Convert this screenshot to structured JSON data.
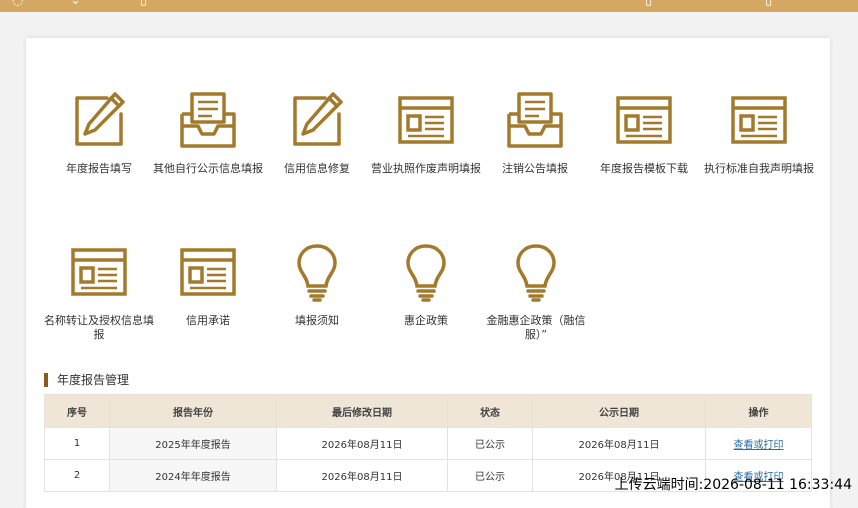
{
  "topbar": {
    "bg": "#d4a862"
  },
  "tiles_row1": [
    {
      "label": "年度报告填写",
      "icon": "pencil-edit-icon"
    },
    {
      "label": "其他自行公示信息填报",
      "icon": "inbox-tray-icon"
    },
    {
      "label": "信用信息修复",
      "icon": "pencil-edit-icon"
    },
    {
      "label": "营业执照作废声明填报",
      "icon": "document-window-icon"
    },
    {
      "label": "注销公告填报",
      "icon": "inbox-tray-icon"
    },
    {
      "label": "年度报告模板下载",
      "icon": "document-window-icon"
    },
    {
      "label": "执行标准自我声明填报",
      "icon": "document-window-icon"
    }
  ],
  "tiles_row2": [
    {
      "label": "名称转让及授权信息填报",
      "icon": "document-window-icon"
    },
    {
      "label": "信用承诺",
      "icon": "document-window-icon"
    },
    {
      "label": "填报须知",
      "icon": "lightbulb-icon"
    },
    {
      "label": "惠企政策",
      "icon": "lightbulb-icon"
    },
    {
      "label": "金融惠企政策（融信服）”",
      "icon": "lightbulb-icon"
    }
  ],
  "annual_report": {
    "title": "年度报告管理",
    "headers": [
      "序号",
      "报告年份",
      "最后修改日期",
      "状态",
      "公示日期",
      "操作"
    ],
    "rows": [
      {
        "no": "1",
        "year": "2025年年度报告",
        "modified": "2026年08月11日",
        "status": "已公示",
        "published": "2026年08月11日",
        "action": "查看或打印"
      },
      {
        "no": "2",
        "year": "2024年年度报告",
        "modified": "2026年08月11日",
        "status": "已公示",
        "published": "2026年08月11日",
        "action": "查看或打印"
      }
    ]
  },
  "watermark": "上传云端时间:2026-08-11 16:33:44",
  "colors": {
    "icon_gold": "#a37a2c",
    "accent_bar": "#8a5a1c",
    "header_bg": "#efe6d8",
    "link": "#2e6da4"
  }
}
